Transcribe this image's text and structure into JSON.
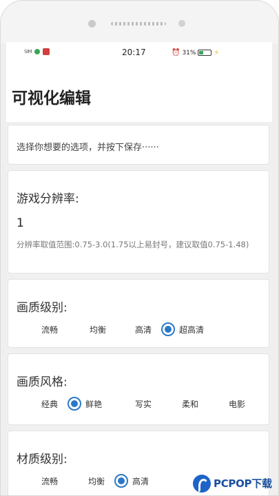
{
  "status_bar": {
    "signal": "SIM",
    "time": "20:17",
    "battery": "31%"
  },
  "header": {
    "title": "可视化编辑"
  },
  "hint": {
    "text": "选择你想要的选项，并按下保存······"
  },
  "resolution": {
    "title": "游戏分辨率:",
    "value": "1",
    "note": "分辨率取值范围:0.75-3.0(1.75以上易封号，建议取值0.75-1.48)"
  },
  "quality": {
    "title": "画质级别:",
    "options": [
      "流畅",
      "均衡",
      "高清",
      "超高清"
    ],
    "selected": "超高清"
  },
  "style": {
    "title": "画质风格:",
    "options": [
      "经典",
      "鲜艳",
      "写实",
      "柔和",
      "电影"
    ],
    "selected": "鲜艳"
  },
  "material": {
    "title": "材质级别:",
    "options": [
      "流畅",
      "均衡",
      "高清"
    ],
    "selected": "高清"
  },
  "watermark": {
    "text": "PCPOP下载"
  },
  "colors": {
    "accent": "#2a78c8",
    "background": "#f0f0f0",
    "card": "#ffffff"
  }
}
